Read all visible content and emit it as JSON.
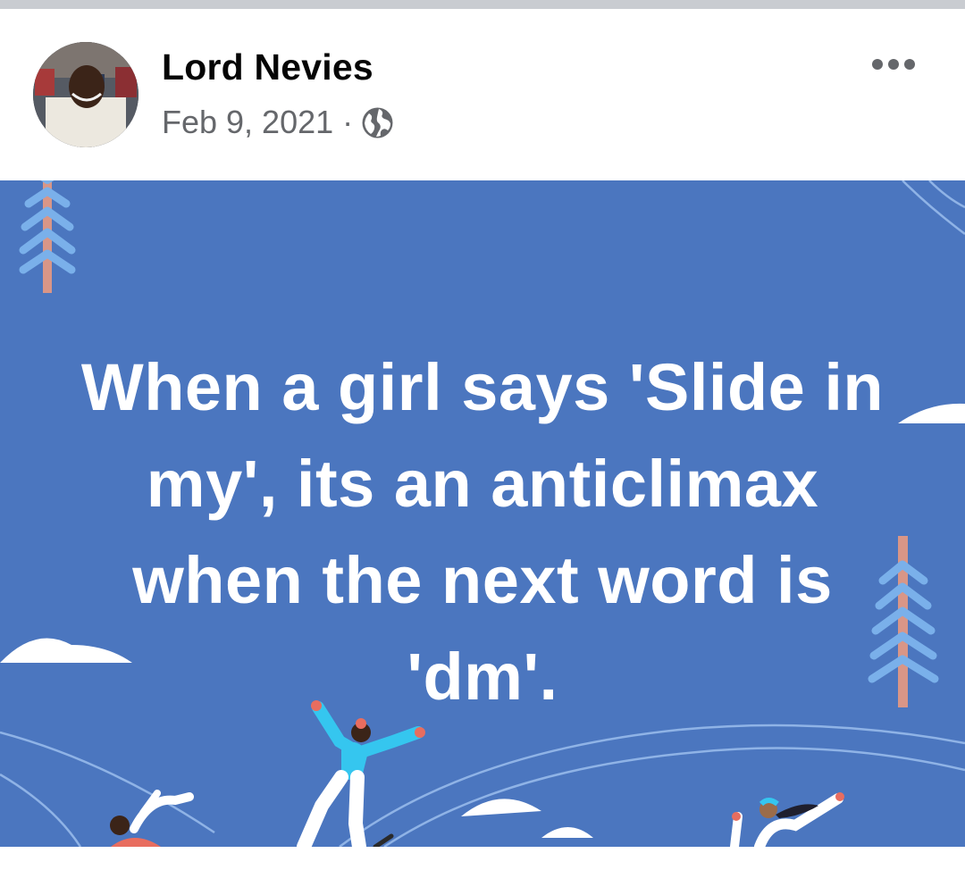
{
  "post": {
    "author": "Lord Nevies",
    "date": "Feb 9, 2021",
    "separator": "·",
    "privacy_icon": "globe-icon",
    "menu_icon": "more-dots-icon",
    "text": "When a girl says 'Slide in my', its an anticlimax when the next word is 'dm'.",
    "background_color": "#4b76bf",
    "text_color": "#ffffff"
  },
  "colors": {
    "name": "#050505",
    "meta": "#65676b",
    "divider": "#c9ccd1"
  }
}
